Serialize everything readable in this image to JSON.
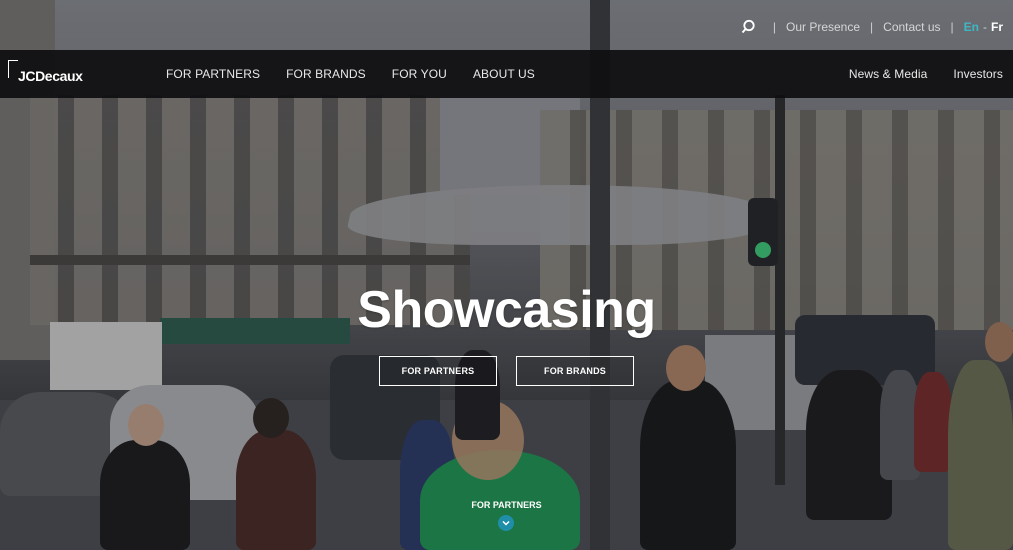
{
  "utility": {
    "search_icon": "search-icon",
    "links": [
      "Our Presence",
      "Contact us"
    ],
    "languages": {
      "active": "En",
      "separator": "-",
      "other": "Fr"
    },
    "colors": {
      "active_lang": "#3eb7c5"
    }
  },
  "nav": {
    "logo_text": "JCDecaux",
    "main_items": [
      "FOR PARTNERS",
      "FOR BRANDS",
      "FOR YOU",
      "ABOUT US"
    ],
    "right_items": [
      "News & Media",
      "Investors"
    ]
  },
  "hero": {
    "title": "Showcasing",
    "ctas": [
      "FOR PARTNERS",
      "FOR BRANDS"
    ],
    "scroll_label": "FOR PARTNERS",
    "scroll_icon": "chevron-down-icon",
    "colors": {
      "scroll_button": "#1f8ea8"
    }
  }
}
